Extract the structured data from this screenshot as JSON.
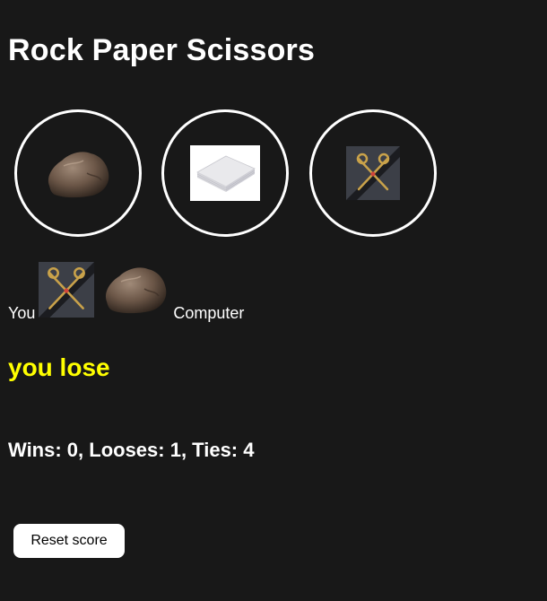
{
  "app": {
    "title": "Rock Paper Scissors"
  },
  "choices": [
    {
      "id": "rock",
      "icon": "rock-icon"
    },
    {
      "id": "paper",
      "icon": "paper-icon"
    },
    {
      "id": "scissors",
      "icon": "scissors-icon"
    }
  ],
  "result": {
    "you_label": "You",
    "computer_label": "Computer",
    "player_move": "scissors",
    "computer_move": "rock",
    "outcome": "you lose"
  },
  "score": {
    "text": "Wins: 0, Looses: 1, Ties: 4"
  },
  "controls": {
    "reset_label": "Reset score"
  },
  "colors": {
    "background": "#181818",
    "outcome": "#ffff00",
    "text": "#ffffff"
  }
}
